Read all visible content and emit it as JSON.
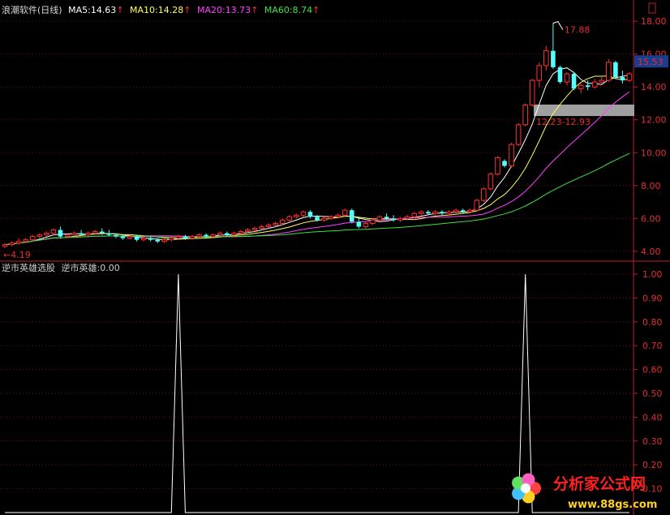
{
  "header": {
    "title": "浪潮软件(日线)",
    "ma5": "MA5:14.63",
    "ma10": "MA10:14.28",
    "ma20": "MA20:13.73",
    "ma60": "MA60:8.74",
    "up_arrow": "↑"
  },
  "indicator": {
    "name": "逆市英雄选股",
    "value_label": "逆市英雄:0.00"
  },
  "price_axis": {
    "ticks": [
      "18.00",
      "16.00",
      "14.00",
      "12.00",
      "10.00",
      "8.00",
      "6.00",
      "4.00"
    ],
    "current_price": "15.53"
  },
  "indicator_axis": {
    "ticks": [
      "1.00",
      "0.90",
      "0.80",
      "0.70",
      "0.60",
      "0.50",
      "0.40",
      "0.30",
      "0.20",
      "0.10"
    ]
  },
  "annotations": {
    "high_label": "17.88",
    "low_label": "4.19",
    "band_label": "12.23-12.93"
  },
  "watermark": {
    "text": "分析家公式网",
    "url": "www.88gs.com"
  },
  "colors": {
    "ma5": "#ffffff",
    "ma10": "#ffff60",
    "ma20": "#ff40ff",
    "ma60": "#40e040",
    "up_candle": "#ff3030",
    "down_candle": "#54ffff",
    "axis": "#c02020"
  },
  "chart_data": [
    {
      "type": "candlestick",
      "y_axis_ticks": [
        4,
        6,
        8,
        10,
        12,
        14,
        16,
        18
      ],
      "ylim": [
        3.5,
        18.6
      ],
      "candles": [
        [
          4.3,
          4.5,
          4.2,
          4.4
        ],
        [
          4.4,
          4.6,
          4.3,
          4.5
        ],
        [
          4.5,
          4.8,
          4.4,
          4.6
        ],
        [
          4.6,
          4.8,
          4.5,
          4.7
        ],
        [
          4.7,
          5.0,
          4.6,
          4.9
        ],
        [
          4.9,
          5.1,
          4.8,
          5.0
        ],
        [
          5.0,
          5.2,
          4.9,
          5.1
        ],
        [
          5.1,
          5.4,
          5.0,
          5.3
        ],
        [
          5.3,
          5.5,
          4.8,
          4.9
        ],
        [
          4.9,
          5.1,
          4.8,
          5.0
        ],
        [
          5.0,
          5.2,
          4.9,
          5.1
        ],
        [
          5.1,
          5.3,
          5.0,
          5.0
        ],
        [
          5.0,
          5.2,
          4.9,
          5.1
        ],
        [
          5.1,
          5.3,
          5.0,
          5.2
        ],
        [
          5.2,
          5.4,
          5.0,
          5.1
        ],
        [
          5.1,
          5.3,
          4.9,
          5.0
        ],
        [
          5.0,
          5.1,
          4.8,
          4.9
        ],
        [
          4.9,
          5.0,
          4.7,
          4.8
        ],
        [
          4.8,
          5.0,
          4.7,
          4.9
        ],
        [
          4.9,
          5.0,
          4.6,
          4.7
        ],
        [
          4.7,
          4.9,
          4.6,
          4.8
        ],
        [
          4.8,
          4.9,
          4.6,
          4.7
        ],
        [
          4.7,
          4.8,
          4.5,
          4.6
        ],
        [
          4.6,
          4.8,
          4.5,
          4.7
        ],
        [
          4.7,
          4.9,
          4.6,
          4.8
        ],
        [
          4.8,
          5.0,
          4.7,
          4.9
        ],
        [
          4.9,
          5.0,
          4.7,
          4.8
        ],
        [
          4.8,
          5.0,
          4.7,
          4.9
        ],
        [
          4.9,
          5.1,
          4.8,
          5.0
        ],
        [
          5.0,
          5.1,
          4.8,
          4.9
        ],
        [
          4.9,
          5.1,
          4.8,
          5.0
        ],
        [
          5.0,
          5.2,
          4.9,
          5.1
        ],
        [
          5.1,
          5.2,
          4.9,
          5.0
        ],
        [
          5.0,
          5.2,
          4.9,
          5.1
        ],
        [
          5.1,
          5.3,
          5.0,
          5.2
        ],
        [
          5.2,
          5.4,
          5.1,
          5.3
        ],
        [
          5.3,
          5.5,
          5.2,
          5.4
        ],
        [
          5.4,
          5.6,
          5.3,
          5.5
        ],
        [
          5.5,
          5.7,
          5.4,
          5.6
        ],
        [
          5.6,
          5.8,
          5.5,
          5.7
        ],
        [
          5.7,
          6.0,
          5.6,
          5.9
        ],
        [
          5.9,
          6.2,
          5.8,
          6.1
        ],
        [
          6.1,
          6.3,
          6.0,
          6.2
        ],
        [
          6.2,
          6.5,
          6.1,
          6.4
        ],
        [
          6.4,
          6.5,
          6.0,
          6.1
        ],
        [
          6.1,
          6.2,
          5.8,
          5.9
        ],
        [
          5.9,
          6.1,
          5.8,
          6.0
        ],
        [
          6.0,
          6.2,
          5.9,
          6.1
        ],
        [
          6.1,
          6.3,
          6.0,
          6.2
        ],
        [
          6.2,
          6.6,
          6.1,
          6.5
        ],
        [
          6.5,
          6.6,
          5.7,
          5.8
        ],
        [
          5.8,
          6.0,
          5.4,
          5.5
        ],
        [
          5.5,
          5.8,
          5.4,
          5.7
        ],
        [
          5.7,
          6.0,
          5.6,
          5.9
        ],
        [
          5.9,
          6.2,
          5.8,
          6.1
        ],
        [
          6.1,
          6.3,
          5.9,
          6.0
        ],
        [
          6.0,
          6.2,
          5.8,
          5.9
        ],
        [
          5.9,
          6.1,
          5.8,
          6.0
        ],
        [
          6.0,
          6.2,
          5.9,
          6.1
        ],
        [
          6.1,
          6.4,
          6.0,
          6.3
        ],
        [
          6.3,
          6.5,
          6.2,
          6.4
        ],
        [
          6.4,
          6.5,
          6.2,
          6.3
        ],
        [
          6.3,
          6.5,
          6.2,
          6.4
        ],
        [
          6.4,
          6.5,
          6.2,
          6.3
        ],
        [
          6.3,
          6.5,
          6.2,
          6.4
        ],
        [
          6.4,
          6.6,
          6.3,
          6.5
        ],
        [
          6.5,
          6.6,
          6.3,
          6.4
        ],
        [
          6.4,
          6.6,
          6.3,
          6.5
        ],
        [
          6.5,
          7.2,
          6.4,
          7.1
        ],
        [
          7.1,
          7.9,
          7.0,
          7.8
        ],
        [
          7.8,
          8.8,
          7.7,
          8.7
        ],
        [
          8.7,
          9.8,
          8.6,
          9.7
        ],
        [
          9.5,
          9.6,
          9.1,
          9.2
        ],
        [
          9.2,
          10.6,
          9.1,
          10.5
        ],
        [
          10.5,
          11.8,
          10.4,
          11.7
        ],
        [
          11.7,
          13.0,
          11.6,
          12.9
        ],
        [
          12.9,
          14.5,
          12.8,
          14.4
        ],
        [
          14.4,
          15.5,
          14.0,
          15.3
        ],
        [
          15.3,
          16.5,
          15.0,
          16.2
        ],
        [
          16.2,
          17.88,
          15.1,
          15.2
        ],
        [
          15.2,
          15.3,
          14.2,
          14.3
        ],
        [
          14.3,
          14.9,
          14.1,
          14.8
        ],
        [
          14.8,
          14.9,
          13.8,
          13.9
        ],
        [
          13.9,
          14.2,
          13.6,
          14.1
        ],
        [
          14.1,
          14.4,
          13.8,
          14.0
        ],
        [
          14.0,
          14.5,
          13.9,
          14.3
        ],
        [
          14.3,
          14.6,
          14.1,
          14.4
        ],
        [
          14.4,
          15.7,
          14.3,
          15.5
        ],
        [
          15.5,
          15.6,
          14.5,
          14.6
        ],
        [
          14.6,
          15.0,
          14.2,
          14.4
        ],
        [
          14.4,
          14.9,
          14.3,
          14.8
        ]
      ],
      "band": [
        12.23,
        12.93
      ]
    },
    {
      "type": "line",
      "name": "逆市英雄",
      "ylim": [
        0,
        1.0
      ],
      "y_axis_ticks": [
        0.1,
        0.2,
        0.3,
        0.4,
        0.5,
        0.6,
        0.7,
        0.8,
        0.9,
        1.0
      ],
      "pulses_at_candle_index": [
        25,
        75
      ],
      "values_description": "0 everywhere except 1.00 at the pulse indices"
    }
  ]
}
